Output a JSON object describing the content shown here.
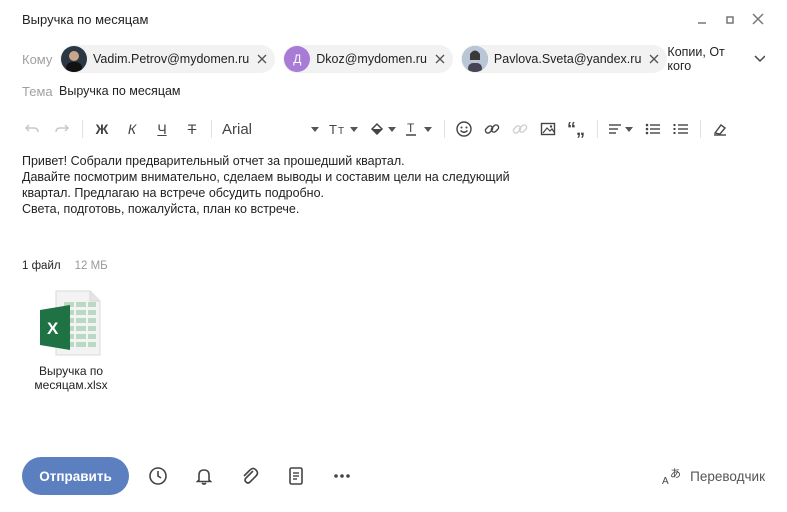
{
  "window": {
    "title": "Выручка по месяцам"
  },
  "recipients": {
    "label": "Кому",
    "items": [
      {
        "email": "Vadim.Petrov@mydomen.ru",
        "avatar": "photo",
        "avatar_color": "#2b3742"
      },
      {
        "email": "Dkoz@mydomen.ru",
        "avatar": "Д",
        "avatar_color": "#a77bd6"
      },
      {
        "email": "Pavlova.Sveta@yandex.ru",
        "avatar": "photo",
        "avatar_color": "#7b8aa0"
      }
    ],
    "copy_from_label": "Копии, От кого"
  },
  "subject": {
    "label": "Тема",
    "value": "Выручка по месяцам"
  },
  "toolbar": {
    "font_name": "Arial",
    "icons": [
      "undo-icon",
      "redo-icon",
      "bold-icon",
      "italic-icon",
      "underline-icon",
      "strikethrough-icon",
      "font-size-icon",
      "fill-color-icon",
      "text-color-icon",
      "emoji-icon",
      "link-icon",
      "unlink-icon",
      "image-icon",
      "quote-icon",
      "align-icon",
      "bulleted-list-icon",
      "numbered-list-icon",
      "clear-format-icon"
    ]
  },
  "message": {
    "lines": [
      "Привет! Собрали предварительный отчет за прошедший квартал.",
      "Давайте посмотрим внимательно, сделаем выводы и составим цели на следующий",
      "квартал. Предлагаю на встрече обсудить подробно.",
      "Света, подготовь, пожалуйста, план ко встрече."
    ]
  },
  "attachments": {
    "count_label": "1 файл",
    "size_label": "12 МБ",
    "files": [
      {
        "name_line1": "Выручка по",
        "name_line2": "месяцам.xlsx",
        "icon": "excel-file-icon"
      }
    ]
  },
  "bottom": {
    "send_label": "Отправить",
    "translator_label": "Переводчик"
  },
  "colors": {
    "accent": "#5c7fbf",
    "excel_green": "#1f7244"
  }
}
